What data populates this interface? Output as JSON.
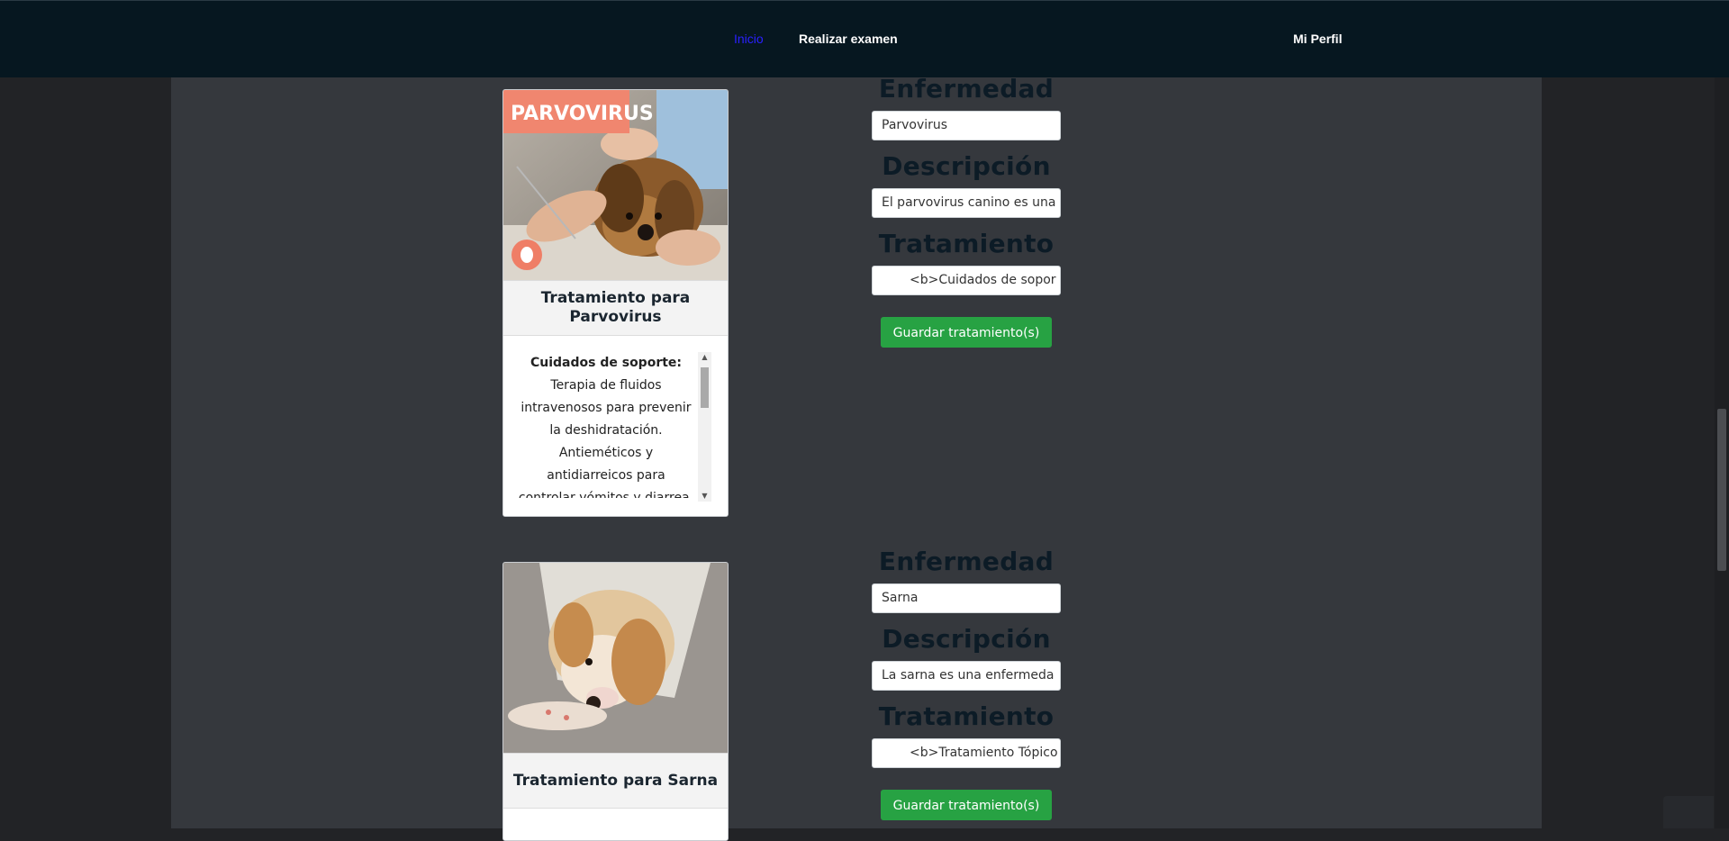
{
  "nav": {
    "links": [
      "Inicio",
      "Realizar examen"
    ],
    "profile": "Mi Perfil"
  },
  "colors": {
    "active_link": "#2a20ff",
    "save_button": "#27a243",
    "navbar_bg": "#061720"
  },
  "cards": [
    {
      "image_banner": "PARVOVIRUS",
      "title": "Tratamiento para Parvovirus",
      "treatment_heading": "Cuidados de soporte:",
      "treatment_text": "Terapia de fluidos intravenosos para prevenir la deshidratación. Antieméticos y antidiarreicos para controlar vómitos y diarrea."
    },
    {
      "title": "Tratamiento para Sarna"
    }
  ],
  "forms": [
    {
      "label_enfermedad": "Enfermedad",
      "enfermedad_value": "Parvovirus",
      "label_descripcion": "Descripción",
      "descripcion_value": "El parvovirus canino es una",
      "label_tratamiento": "Tratamiento",
      "tratamiento_value": "<b>Cuidados de sopor",
      "save_label": "Guardar tratamiento(s)"
    },
    {
      "label_enfermedad": "Enfermedad",
      "enfermedad_value": "Sarna",
      "label_descripcion": "Descripción",
      "descripcion_value": "La sarna es una enfermeda",
      "label_tratamiento": "Tratamiento",
      "tratamiento_value": "<b>Tratamiento Tópico",
      "save_label": "Guardar tratamiento(s)"
    }
  ]
}
